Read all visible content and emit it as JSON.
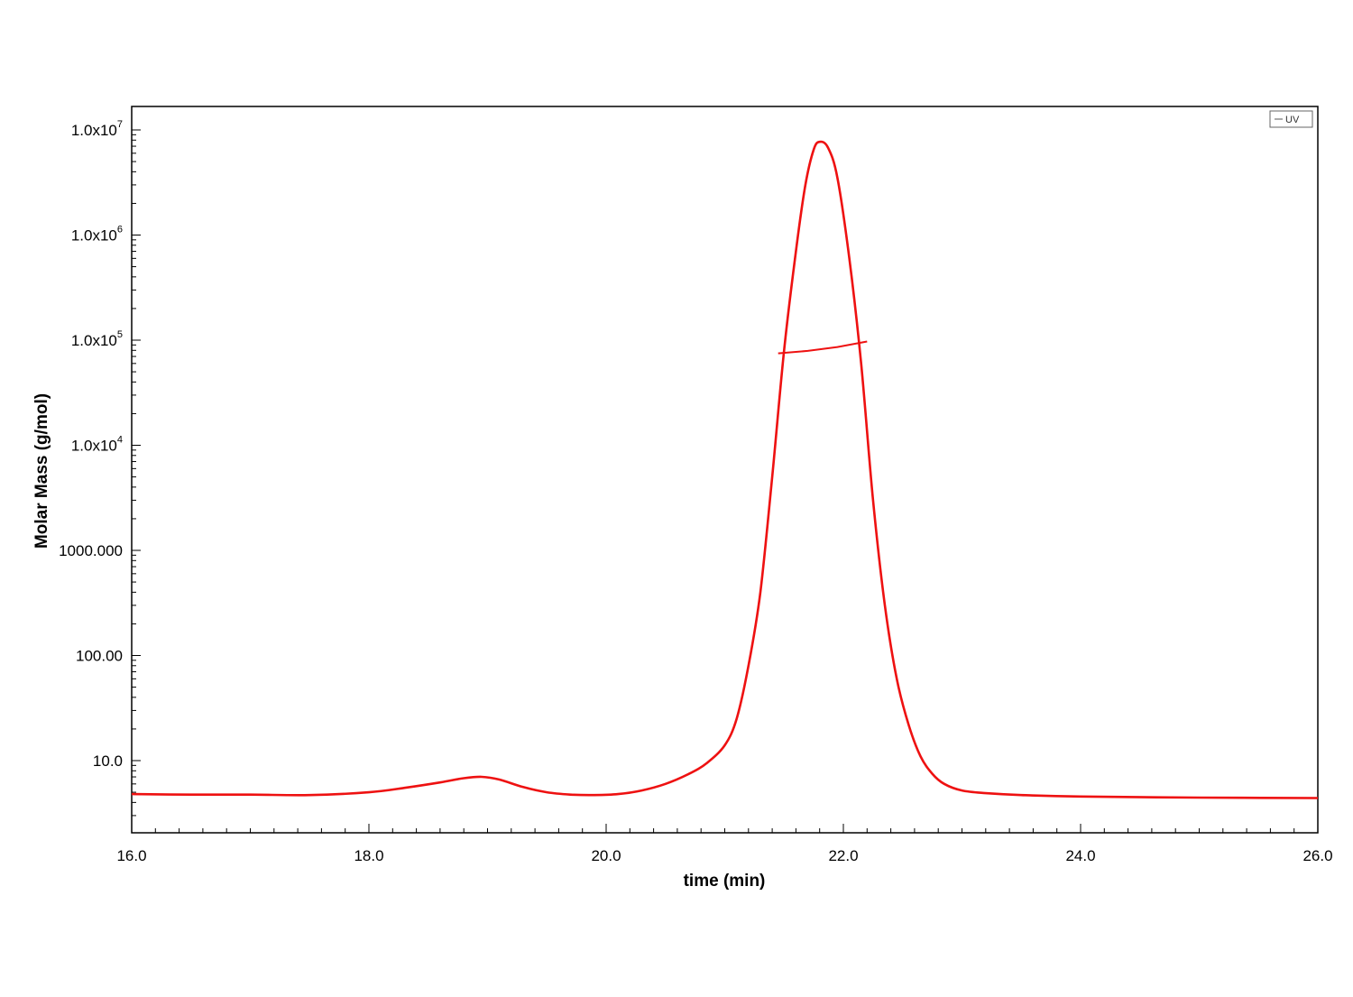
{
  "chart_data": {
    "type": "line",
    "title": "",
    "xlabel": "time (min)",
    "ylabel": "Molar Mass (g/mol)",
    "xlim": [
      16.0,
      26.0
    ],
    "yscale": "log",
    "ylim": [
      2,
      20000000
    ],
    "grid": false,
    "legend": {
      "placement": "top-right",
      "entries": [
        "UV"
      ]
    },
    "x_ticks": [
      {
        "value": 16.0,
        "label": "16.0"
      },
      {
        "value": 18.0,
        "label": "18.0"
      },
      {
        "value": 20.0,
        "label": "20.0"
      },
      {
        "value": 22.0,
        "label": "22.0"
      },
      {
        "value": 24.0,
        "label": "24.0"
      },
      {
        "value": 26.0,
        "label": "26.0"
      }
    ],
    "y_ticks": [
      {
        "value": 10,
        "label": "10.0"
      },
      {
        "value": 100,
        "label": "100.00"
      },
      {
        "value": 1000,
        "label": "1000.000"
      },
      {
        "value": 10000,
        "label": "1.0x10",
        "exp": "4"
      },
      {
        "value": 100000,
        "label": "1.0x10",
        "exp": "5"
      },
      {
        "value": 1000000,
        "label": "1.0x10",
        "exp": "6"
      },
      {
        "value": 10000000,
        "label": "1.0x10",
        "exp": "7"
      }
    ],
    "series": [
      {
        "name": "UV",
        "color": "#ee1111",
        "x": [
          16.0,
          16.5,
          17.0,
          17.5,
          18.0,
          18.3,
          18.6,
          18.8,
          18.95,
          19.1,
          19.3,
          19.5,
          19.7,
          19.9,
          20.1,
          20.3,
          20.5,
          20.7,
          20.85,
          21.0,
          21.1,
          21.2,
          21.3,
          21.4,
          21.5,
          21.6,
          21.68,
          21.75,
          21.8,
          21.87,
          21.95,
          22.05,
          22.15,
          22.25,
          22.35,
          22.45,
          22.55,
          22.65,
          22.75,
          22.85,
          23.0,
          23.2,
          23.5,
          24.0,
          25.0,
          26.0
        ],
        "y": [
          4.8,
          4.75,
          4.75,
          4.7,
          5.0,
          5.5,
          6.2,
          6.8,
          7.0,
          6.6,
          5.6,
          5.0,
          4.75,
          4.7,
          4.8,
          5.2,
          6.0,
          7.5,
          9.5,
          14,
          25,
          80,
          400,
          5000,
          80000,
          700000,
          3000000,
          6500000,
          7700000,
          6800000,
          3500000,
          600000,
          60000,
          3000,
          300,
          60,
          22,
          11,
          7.5,
          6,
          5.2,
          4.9,
          4.7,
          4.55,
          4.45,
          4.4
        ]
      }
    ],
    "annotations": [
      {
        "type": "molar-mass-trace",
        "color": "#ee1111",
        "x": [
          21.45,
          21.7,
          21.95,
          22.2
        ],
        "y": [
          75000,
          79000,
          86000,
          97000
        ]
      }
    ]
  }
}
